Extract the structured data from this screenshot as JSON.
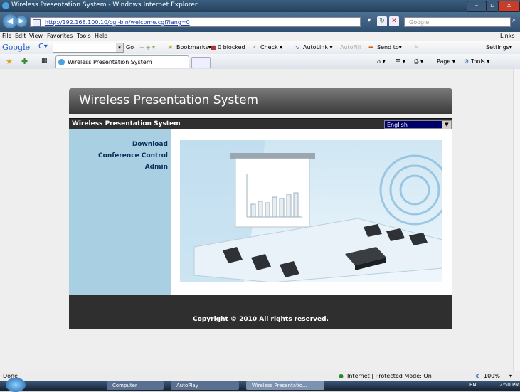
{
  "window": {
    "title": "Wireless Presentation System - Windows Internet Explorer",
    "minimize": "–",
    "maximize": "▫",
    "close": "x"
  },
  "address": {
    "url": "http://192.168.100.10/cgi-bin/welcome.cgi?lang=0",
    "search_placeholder": "Google",
    "refresh": "↻",
    "stop": "✕",
    "search_go": "⌕"
  },
  "menu": [
    "File",
    "Edit",
    "View",
    "Favorites",
    "Tools",
    "Help"
  ],
  "menu_links": "Links",
  "google_toolbar": {
    "logo": "Google",
    "g_label": "G▾",
    "go": "Go",
    "bookmarks": "Bookmarks▾",
    "blocked": "0 blocked",
    "check": "Check ▾",
    "autolink": "AutoLink ▾",
    "autofill": "AutoFill",
    "send_to": "Send to▾",
    "settings": "Settings▾"
  },
  "tab": {
    "title": "Wireless Presentation System"
  },
  "command_bar": {
    "page": "Page ▾",
    "tools": "Tools ▾"
  },
  "page": {
    "banner_title": "Wireless Presentation System",
    "sub_title": "Wireless Presentation System",
    "language": "English",
    "nav": [
      "Download",
      "Conference Control",
      "Admin"
    ],
    "copyright": "Copyright © 2010 All rights reserved."
  },
  "status": {
    "left": "Done",
    "zone": "Internet | Protected Mode: On",
    "zoom": "100%"
  },
  "taskbar": {
    "items": [
      "Computer",
      "AutoPlay",
      "Wireless Presentatio..."
    ],
    "lang": "EN",
    "time": "2:50 PM"
  }
}
